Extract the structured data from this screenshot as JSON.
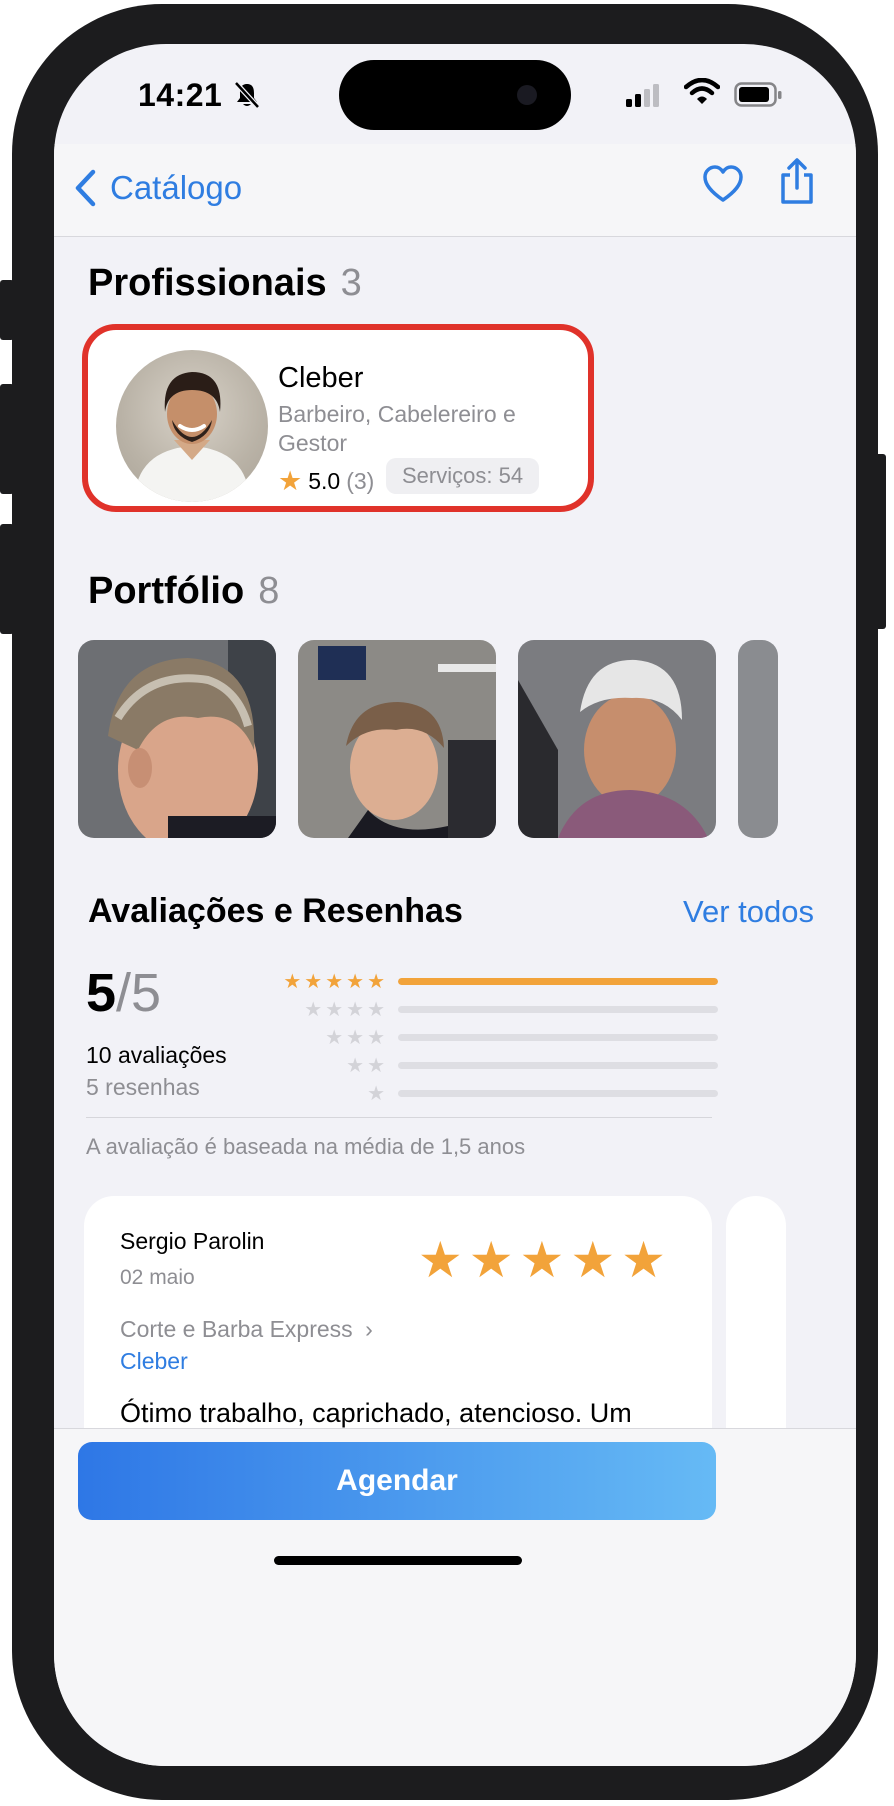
{
  "status_bar": {
    "time": "14:21",
    "icons": [
      "bell-slash-icon",
      "signal-icon",
      "wifi-icon",
      "battery-icon"
    ]
  },
  "navbar": {
    "back_label": "Catálogo",
    "icons": [
      "chevron-left-icon",
      "heart-icon",
      "share-icon"
    ]
  },
  "professionals": {
    "title": "Profissionais",
    "count": "3",
    "items": [
      {
        "name": "Cleber",
        "role": "Barbeiro, Cabelereiro e Gestor",
        "rating": "5.0",
        "rating_count": "(3)",
        "services": "Serviços: 54"
      }
    ]
  },
  "portfolio": {
    "title": "Portfólio",
    "count": "8"
  },
  "ratings": {
    "title": "Avaliações e Resenhas",
    "see_all": "Ver todos",
    "score": "5",
    "score_denominator": "/5",
    "evaluations": "10 avaliações",
    "reviews": "5 resenhas",
    "distribution": [
      {
        "stars": 5,
        "fraction": 1.0
      },
      {
        "stars": 4,
        "fraction": 0.0
      },
      {
        "stars": 3,
        "fraction": 0.0
      },
      {
        "stars": 2,
        "fraction": 0.0
      },
      {
        "stars": 1,
        "fraction": 0.0
      }
    ],
    "note": "A avaliação é baseada na média de 1,5 anos"
  },
  "review": {
    "author": "Sergio Parolin",
    "date": "02 maio",
    "stars": 5,
    "service": "Corte e Barba Express",
    "professional": "Cleber",
    "text": "Ótimo trabalho, caprichado, atencioso. Um"
  },
  "cta": {
    "label": "Agendar"
  },
  "colors": {
    "accent": "#2f7de1",
    "star": "#f2a33a",
    "highlight_border": "#e0322a"
  }
}
